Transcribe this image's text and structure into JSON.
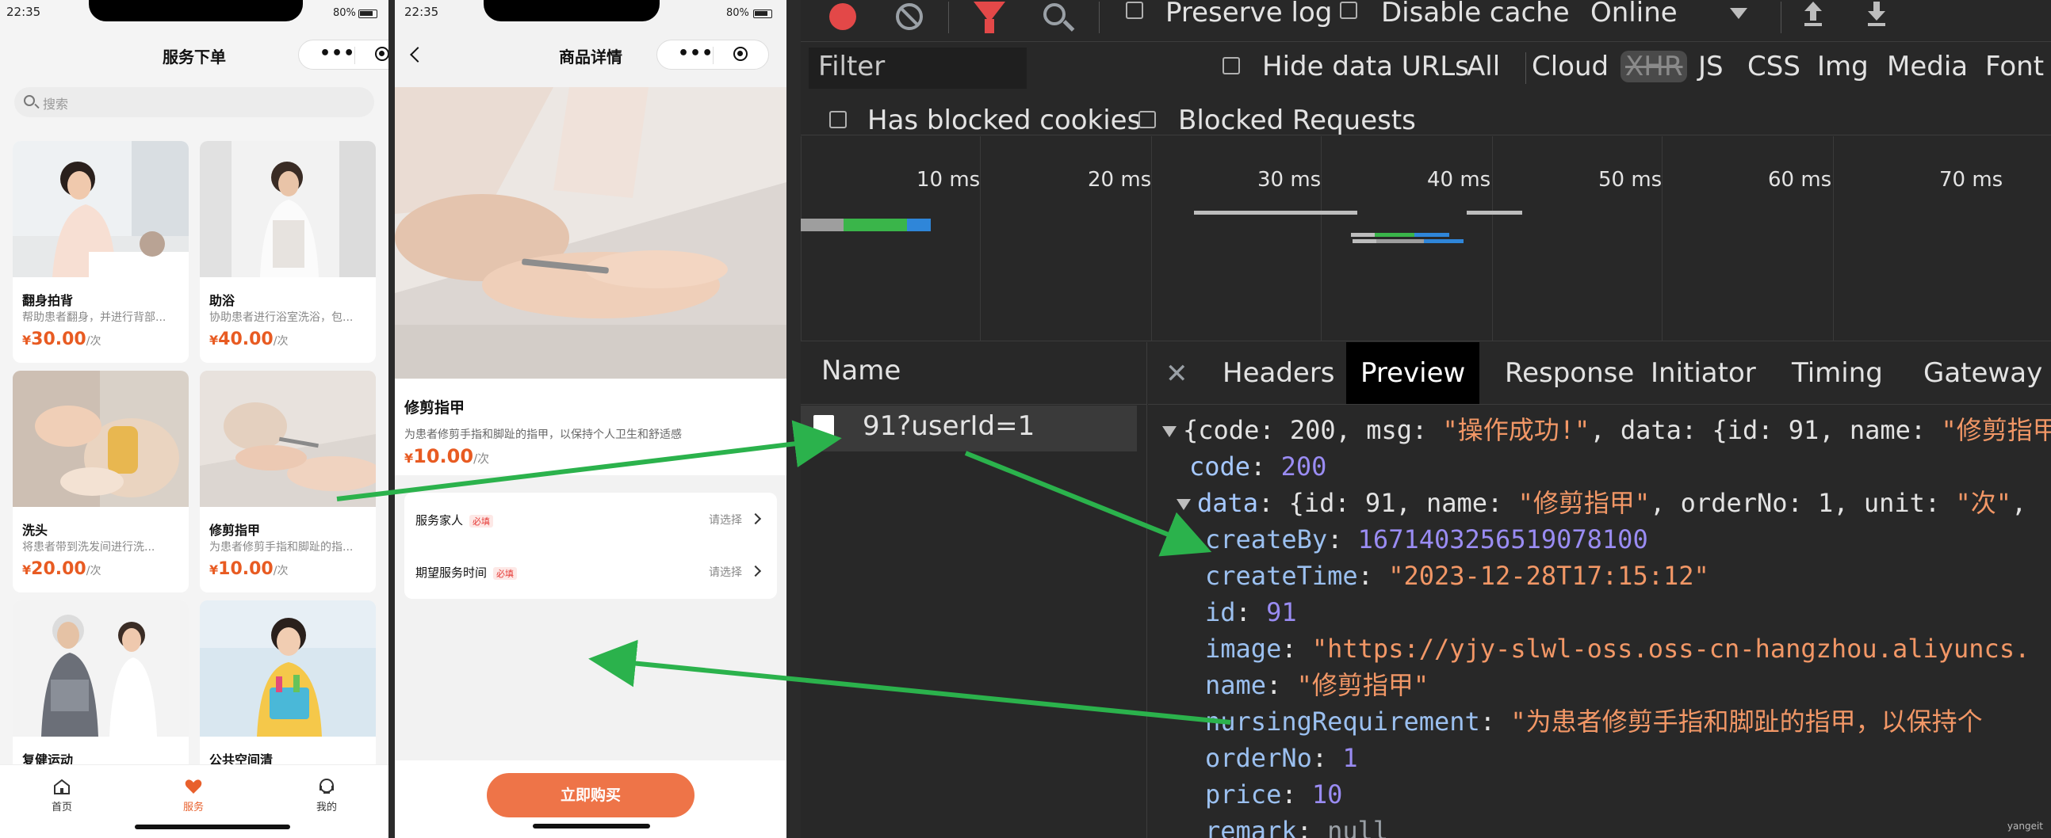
{
  "phone1": {
    "status": {
      "time": "22:35",
      "battery": "80%"
    },
    "title": "服务下单",
    "search_placeholder": "搜索",
    "cards": [
      {
        "title": "翻身拍背",
        "desc": "帮助患者翻身，并进行背部...",
        "yen": "¥",
        "price": "30.00",
        "unit": "/次"
      },
      {
        "title": "助浴",
        "desc": "协助患者进行浴室洗浴，包...",
        "yen": "¥",
        "price": "40.00",
        "unit": "/次"
      },
      {
        "title": "洗头",
        "desc": "将患者带到洗发间进行洗...",
        "yen": "¥",
        "price": "20.00",
        "unit": "/次"
      },
      {
        "title": "修剪指甲",
        "desc": "为患者修剪手指和脚趾的指...",
        "yen": "¥",
        "price": "10.00",
        "unit": "/次"
      },
      {
        "title": "复健运动"
      },
      {
        "title": "公共空间清"
      }
    ],
    "tabs": [
      {
        "label": "首页",
        "icon": "home-icon"
      },
      {
        "label": "服务",
        "icon": "service-heart-icon",
        "active": true
      },
      {
        "label": "我的",
        "icon": "user-headset-icon"
      }
    ]
  },
  "phone2": {
    "status": {
      "time": "22:35",
      "battery": "80%"
    },
    "title": "商品详情",
    "product": {
      "name": "修剪指甲",
      "desc": "为患者修剪手指和脚趾的指甲，以保持个人卫生和舒适感",
      "yen": "¥",
      "price": "10.00",
      "unit": "/次"
    },
    "form": [
      {
        "label": "服务家人",
        "required": "必填",
        "value": "请选择"
      },
      {
        "label": "期望服务时间",
        "required": "必填",
        "value": "请选择"
      }
    ],
    "buy_label": "立即购买"
  },
  "devtools": {
    "toolbar": {
      "preserve_log": "Preserve log",
      "disable_cache": "Disable cache",
      "throttle": "Online"
    },
    "filter_placeholder": "Filter",
    "hide_data_urls": "Hide data URLs",
    "type_filters": [
      "All",
      "Cloud",
      "XHR",
      "JS",
      "CSS",
      "Img",
      "Media",
      "Font"
    ],
    "selected_filter": "XHR",
    "has_blocked_cookies": "Has blocked cookies",
    "blocked_requests": "Blocked Requests",
    "timeline_ticks": [
      "10 ms",
      "20 ms",
      "30 ms",
      "40 ms",
      "50 ms",
      "60 ms",
      "70 ms"
    ],
    "name_header": "Name",
    "request_name": "91?userId=1",
    "detail_tabs": [
      "Headers",
      "Preview",
      "Response",
      "Initiator",
      "Timing",
      "Gateway"
    ],
    "active_tab": "Preview",
    "preview": {
      "summary_prefix": "{code: 200, msg: ",
      "summary_msg": "\"操作成功!\"",
      "summary_mid": ", data: {id: 91, name: ",
      "summary_name": "\"修剪指甲\"",
      "code_key": "code",
      "code_val": "200",
      "data_key": "data",
      "data_summary_a": "{id: 91, name: ",
      "data_summary_name": "\"修剪指甲\"",
      "data_summary_b": ", orderNo: 1, unit: ",
      "data_summary_unit": "\"次\"",
      "fields": [
        {
          "key": "createBy",
          "val": "1671403256519078100",
          "type": "num"
        },
        {
          "key": "createTime",
          "val": "\"2023-12-28T17:15:12\"",
          "type": "str"
        },
        {
          "key": "id",
          "val": "91",
          "type": "num"
        },
        {
          "key": "image",
          "val": "\"https://yjy-slwl-oss.oss-cn-hangzhou.aliyuncs.",
          "type": "str"
        },
        {
          "key": "name",
          "val": "\"修剪指甲\"",
          "type": "str"
        },
        {
          "key": "nursingRequirement",
          "val": "\"为患者修剪手指和脚趾的指甲，以保持个",
          "type": "str"
        },
        {
          "key": "orderNo",
          "val": "1",
          "type": "num"
        },
        {
          "key": "price",
          "val": "10",
          "type": "num"
        },
        {
          "key": "remark",
          "val": "null",
          "type": "null"
        }
      ]
    },
    "watermark": "yangeit"
  },
  "colors": {
    "accent": "#e8602c",
    "arrow": "#2bb24c",
    "record": "#e34848"
  }
}
